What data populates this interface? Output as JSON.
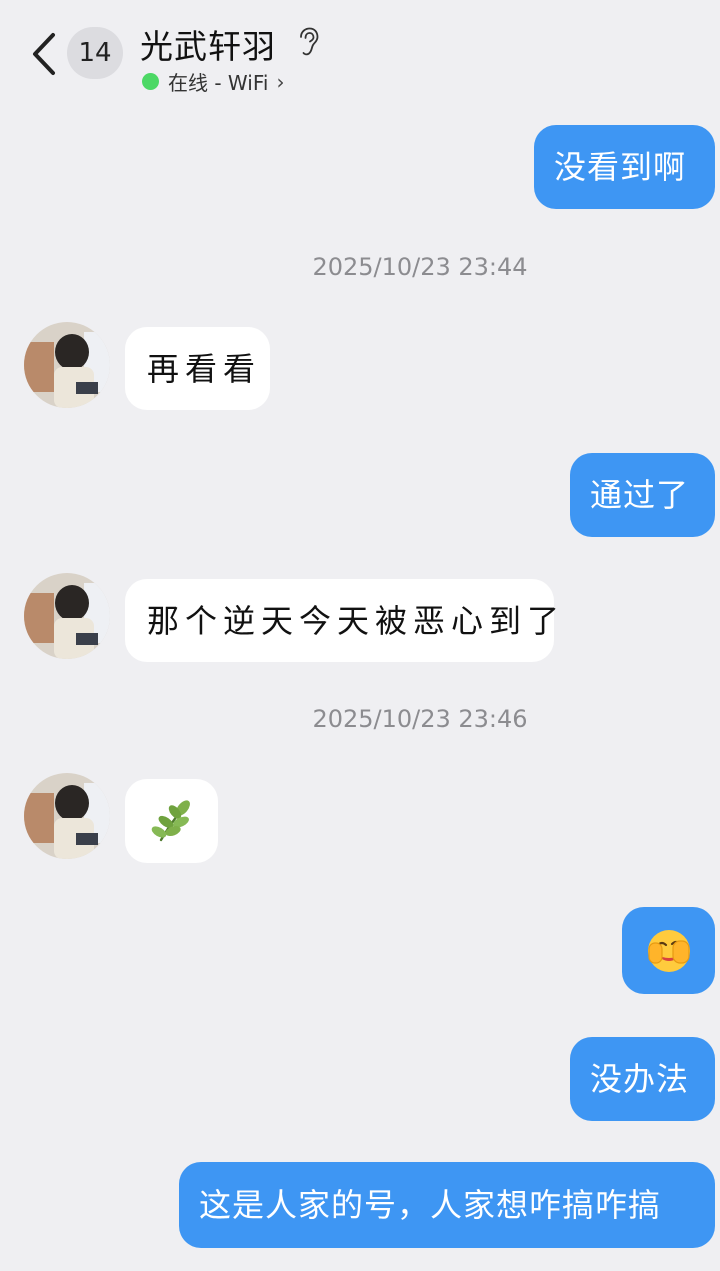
{
  "header": {
    "unread_count": "14",
    "contact_name": "光武轩羽",
    "status_text": "在线 - WiFi",
    "status_chevron": "›",
    "back_icon": "chevron-left-icon",
    "ear_icon": "ear-icon"
  },
  "messages": [
    {
      "direction": "out",
      "text": "没看到啊"
    },
    {
      "type": "timestamp",
      "text": "2025/10/23 23:44"
    },
    {
      "direction": "in",
      "text": "再看看"
    },
    {
      "direction": "out",
      "text": "通过了"
    },
    {
      "direction": "in",
      "text": "那个逆天今天被恶心到了"
    },
    {
      "type": "timestamp",
      "text": "2025/10/23 23:46"
    },
    {
      "direction": "in",
      "emoji": "🌿"
    },
    {
      "direction": "out",
      "emoji": "🫣"
    },
    {
      "direction": "out",
      "text": "没办法"
    },
    {
      "direction": "out",
      "text": "这是人家的号，人家想咋搞咋搞"
    }
  ],
  "colors": {
    "background": "#efeff2",
    "outgoing_bubble": "#3e96f3",
    "incoming_bubble": "#ffffff",
    "online_dot": "#4cd865",
    "timestamp_text": "#8c8c90"
  }
}
